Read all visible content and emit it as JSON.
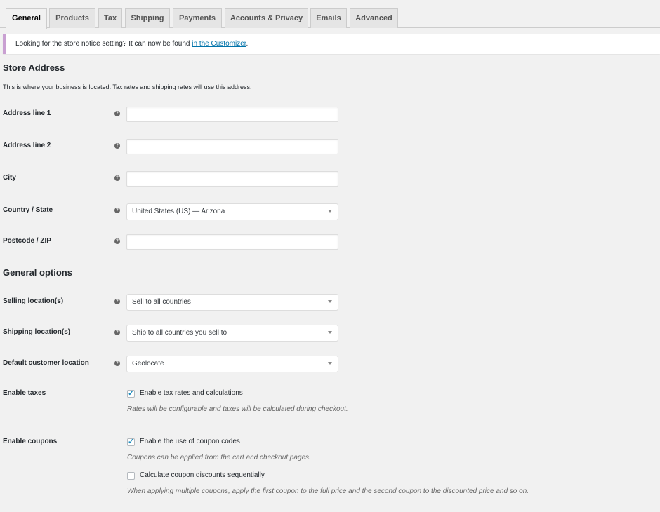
{
  "tabs": [
    {
      "label": "General",
      "active": true
    },
    {
      "label": "Products",
      "active": false
    },
    {
      "label": "Tax",
      "active": false
    },
    {
      "label": "Shipping",
      "active": false
    },
    {
      "label": "Payments",
      "active": false
    },
    {
      "label": "Accounts & Privacy",
      "active": false
    },
    {
      "label": "Emails",
      "active": false
    },
    {
      "label": "Advanced",
      "active": false
    }
  ],
  "notice": {
    "text": "Looking for the store notice setting? It can now be found ",
    "link": "in the Customizer",
    "suffix": "."
  },
  "store_address": {
    "heading": "Store Address",
    "description": "This is where your business is located. Tax rates and shipping rates will use this address.",
    "fields": {
      "address1": {
        "label": "Address line 1",
        "value": ""
      },
      "address2": {
        "label": "Address line 2",
        "value": ""
      },
      "city": {
        "label": "City",
        "value": ""
      },
      "country": {
        "label": "Country / State",
        "value": "United States (US) — Arizona"
      },
      "postcode": {
        "label": "Postcode / ZIP",
        "value": ""
      }
    }
  },
  "general_options": {
    "heading": "General options",
    "selling": {
      "label": "Selling location(s)",
      "value": "Sell to all countries"
    },
    "shipping": {
      "label": "Shipping location(s)",
      "value": "Ship to all countries you sell to"
    },
    "customer_location": {
      "label": "Default customer location",
      "value": "Geolocate"
    },
    "taxes": {
      "label": "Enable taxes",
      "checkbox_label": "Enable tax rates and calculations",
      "checked": true,
      "hint": "Rates will be configurable and taxes will be calculated during checkout."
    },
    "coupons": {
      "label": "Enable coupons",
      "checkbox_label": "Enable the use of coupon codes",
      "checked": true,
      "hint": "Coupons can be applied from the cart and checkout pages.",
      "sequential_label": "Calculate coupon discounts sequentially",
      "sequential_checked": false,
      "sequential_hint": "When applying multiple coupons, apply the first coupon to the full price and the second coupon to the discounted price and so on."
    }
  },
  "icons": {
    "help": "help-tip-icon",
    "arrow": "dropdown-arrow-icon",
    "check": "checkmark-icon"
  },
  "colors": {
    "link": "#0073aa",
    "notice_border": "#c9a0d2",
    "checkmark": "#1e8cbe"
  }
}
